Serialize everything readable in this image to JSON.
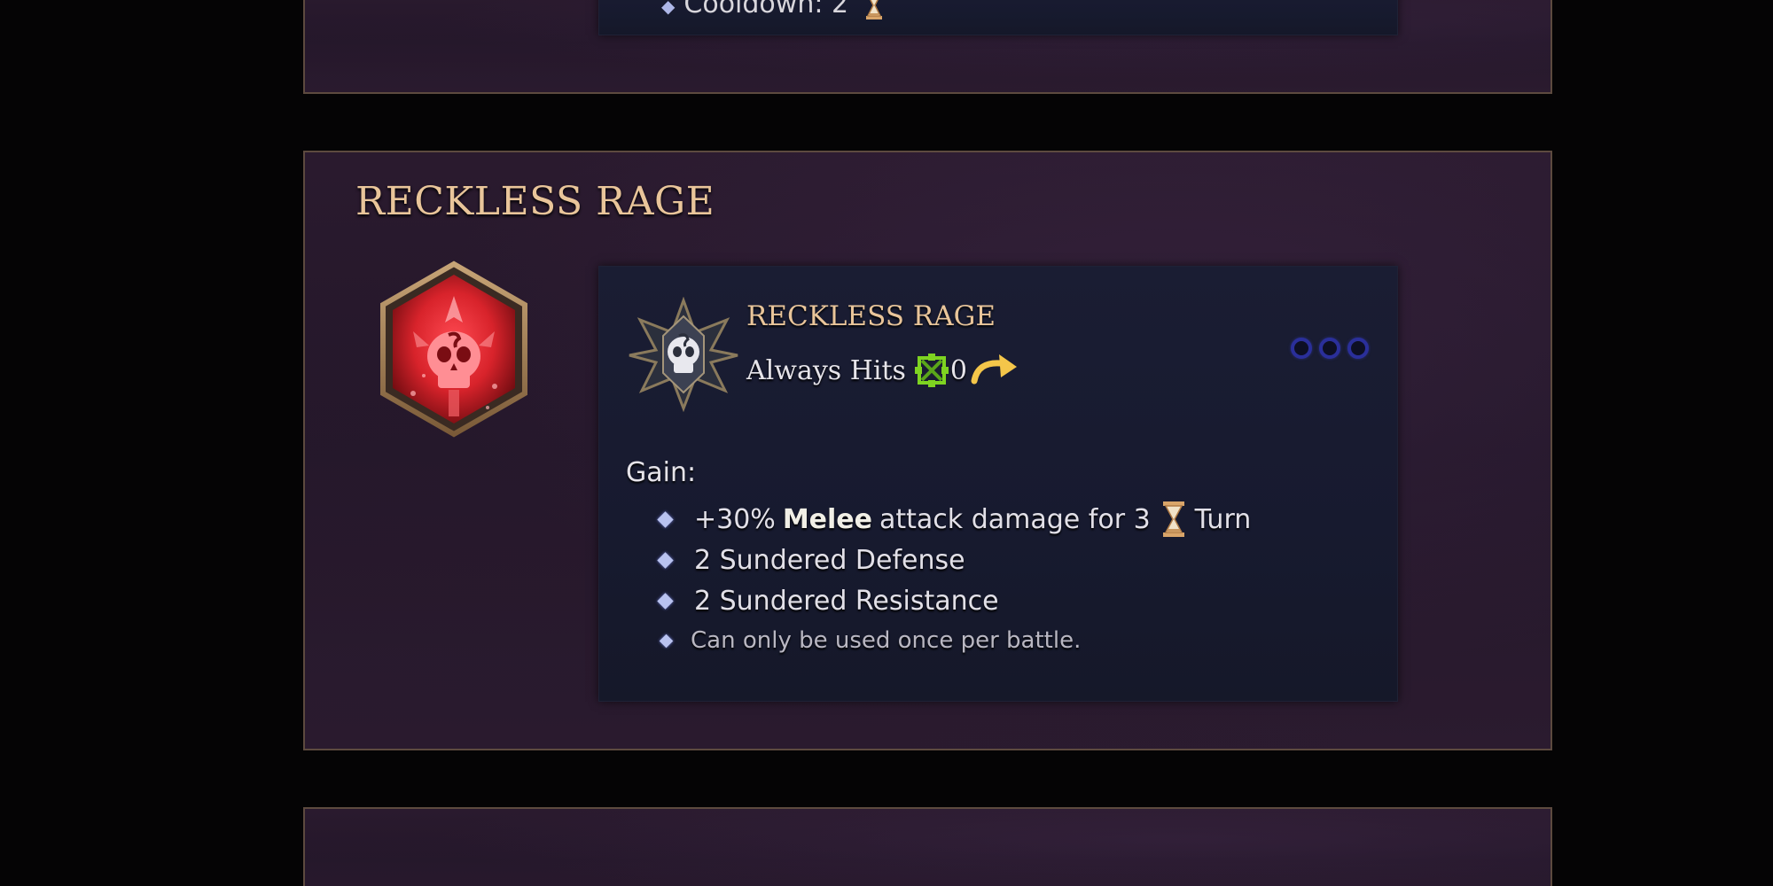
{
  "previous_card": {
    "tooltip_text": "Cooldown: 2"
  },
  "ability_card": {
    "title": "RECKLESS RAGE",
    "icon": "red-skull-hexagon-icon",
    "tooltip": {
      "emblem": "spiked-skull-emblem-icon",
      "title": "RECKLESS RAGE",
      "accuracy_label": "Always Hits",
      "accuracy_icon": "green-crosshair-icon",
      "ap_cost": "0",
      "action_icon": "curved-arrow-icon",
      "charges_icon": "blue-charge-pip",
      "charge_pips": 3,
      "gain_label": "Gain:",
      "effects": [
        {
          "prefix": "+30%",
          "keyword": "Melee",
          "text": "attack damage for 3",
          "icon": "hourglass-icon",
          "suffix": "Turn"
        },
        {
          "text": "2 Sundered Defense"
        },
        {
          "text": "2 Sundered Resistance"
        }
      ],
      "note": "Can only be used once per battle."
    }
  },
  "colors": {
    "background": "#050405",
    "card_bg": "#24172a",
    "card_border": "#5d4a3f",
    "title_gold": "#e9c59a",
    "tooltip_bg": "#171a2f",
    "pip_blue": "#2a2f9a",
    "bullet_blue": "#b9c3f0",
    "crosshair_green": "#7ed321",
    "arrow_yellow": "#f4c64a",
    "icon_red": "#d8232b"
  }
}
